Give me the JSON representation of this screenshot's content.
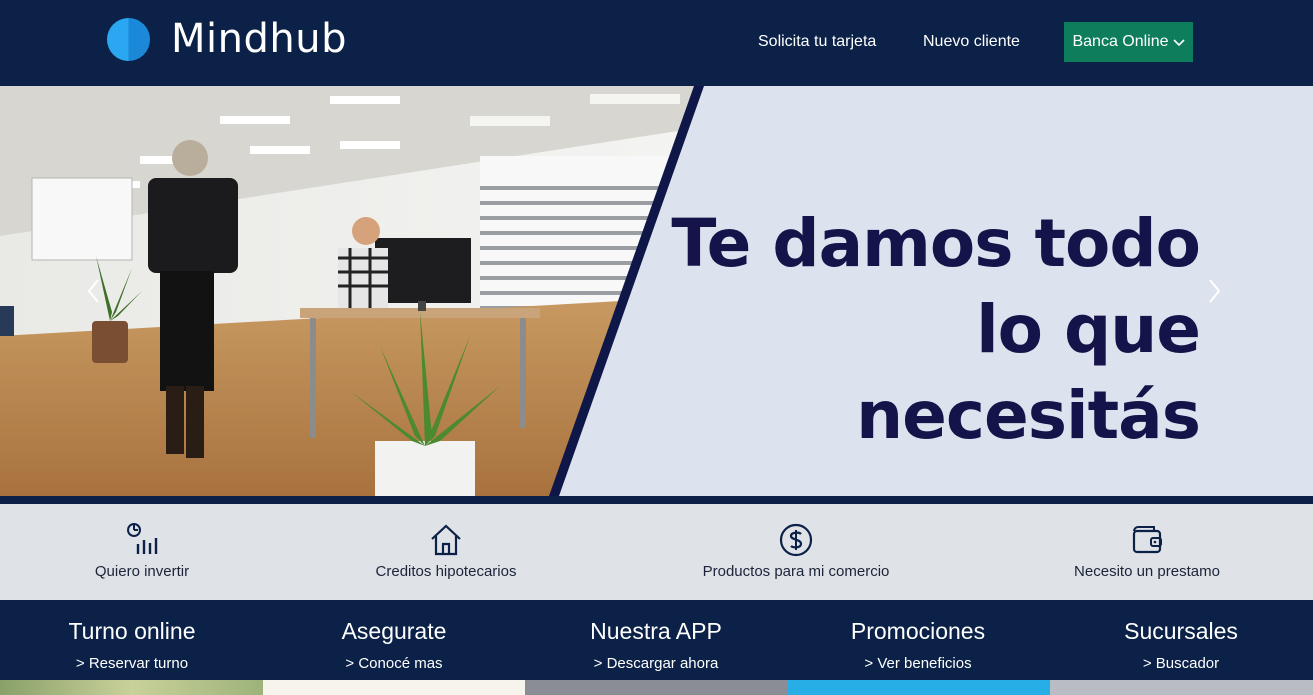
{
  "header": {
    "brand": "Mindhub",
    "nav": [
      "Solicita tu tarjeta",
      "Nuevo cliente"
    ],
    "online_button": "Banca Online",
    "colors": {
      "navy": "#0b2147",
      "button_green": "#0d7d5c",
      "logo_blue": "#2aa7f0"
    }
  },
  "hero": {
    "title_line1": "Te damos todo",
    "title_line2": "lo que necesitás",
    "photo_description_icon": "office-photo",
    "prev_icon": "chevron-left-icon",
    "next_icon": "chevron-right-icon"
  },
  "quick_links": [
    {
      "label": "Quiero invertir",
      "icon": "investment-chart-icon"
    },
    {
      "label": "Creditos hipotecarios",
      "icon": "house-icon"
    },
    {
      "label": "Productos para mi comercio",
      "icon": "dollar-circle-icon"
    },
    {
      "label": "Necesito un prestamo",
      "icon": "wallet-icon"
    }
  ],
  "services": [
    {
      "title": "Turno online",
      "link": "> Reservar turno"
    },
    {
      "title": "Asegurate",
      "link": "> Conocé mas"
    },
    {
      "title": "Nuestra APP",
      "link": "> Descargar ahora"
    },
    {
      "title": "Promociones",
      "link": "> Ver beneficios"
    },
    {
      "title": "Sucursales",
      "link": "> Buscador"
    }
  ]
}
